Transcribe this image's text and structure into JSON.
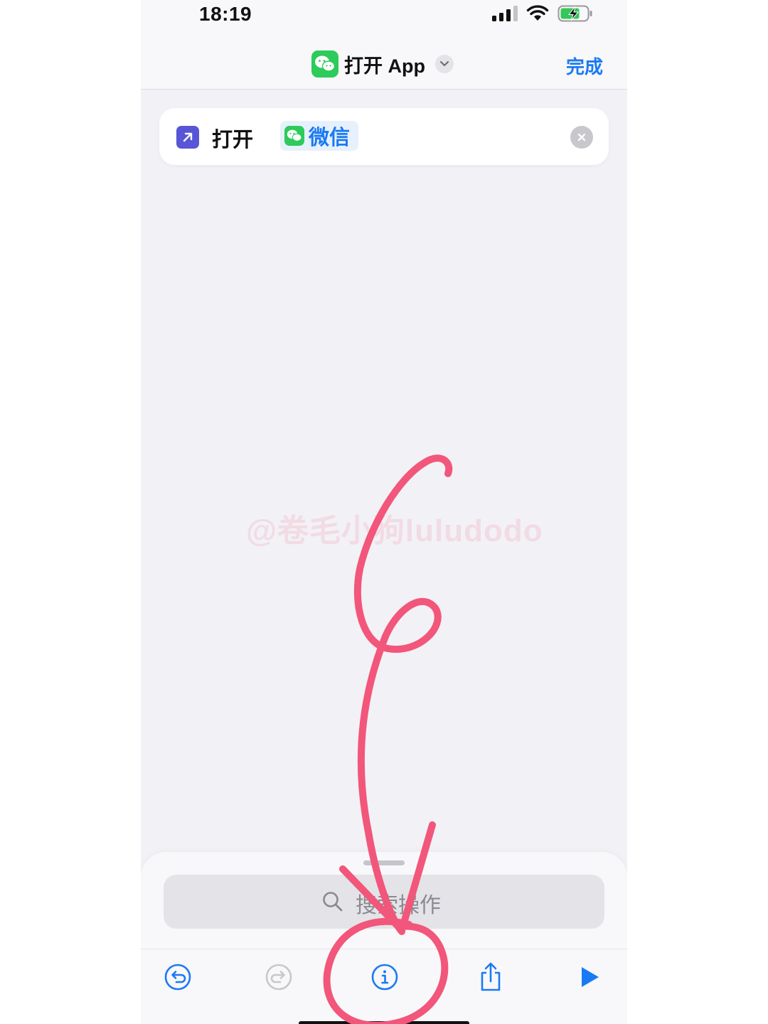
{
  "status_bar": {
    "time": "18:19"
  },
  "nav": {
    "title": "打开 App",
    "done_label": "完成"
  },
  "action": {
    "verb": "打开",
    "app_name": "微信"
  },
  "watermark": "@卷毛小狗luludodo",
  "search": {
    "placeholder": "搜索操作"
  },
  "toolbar": {
    "icons": [
      "undo-icon",
      "redo-icon",
      "info-icon",
      "share-icon",
      "play-icon"
    ]
  },
  "colors": {
    "accent": "#1a7af3",
    "wechat": "#2ccb5a",
    "open_action": "#5856d6",
    "annotation": "#f2567a",
    "background": "#f2f1f6"
  }
}
